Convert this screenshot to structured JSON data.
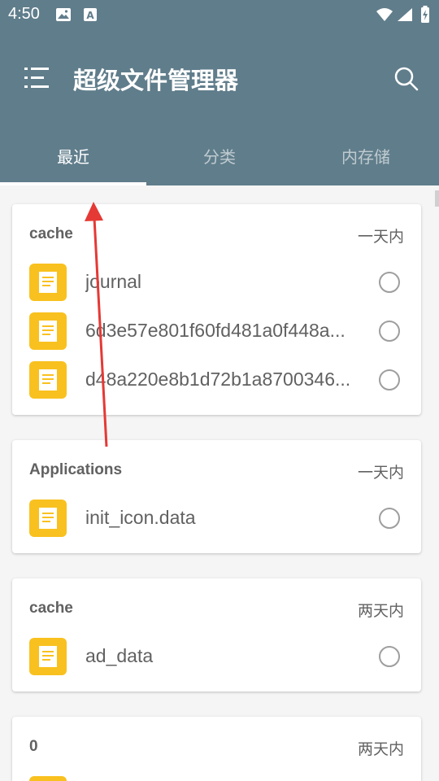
{
  "status": {
    "time": "4:50"
  },
  "toolbar": {
    "title": "超级文件管理器",
    "menu_icon": "menu-icon",
    "search_icon": "search-icon"
  },
  "tabs": [
    {
      "label": "最近",
      "active": true
    },
    {
      "label": "分类",
      "active": false
    },
    {
      "label": "内存储",
      "active": false
    }
  ],
  "groups": [
    {
      "name": "cache",
      "time": "一天内",
      "files": [
        {
          "name": "journal"
        },
        {
          "name": "6d3e57e801f60fd481a0f448a..."
        },
        {
          "name": "d48a220e8b1d72b1a8700346..."
        }
      ]
    },
    {
      "name": "Applications",
      "time": "一天内",
      "files": [
        {
          "name": "init_icon.data"
        }
      ]
    },
    {
      "name": "cache",
      "time": "两天内",
      "files": [
        {
          "name": "ad_data"
        }
      ]
    },
    {
      "name": "0",
      "time": "两天内",
      "files": []
    }
  ],
  "colors": {
    "header": "#607d8b",
    "file_icon": "#f9c11f",
    "annotation_arrow": "#e53935"
  }
}
